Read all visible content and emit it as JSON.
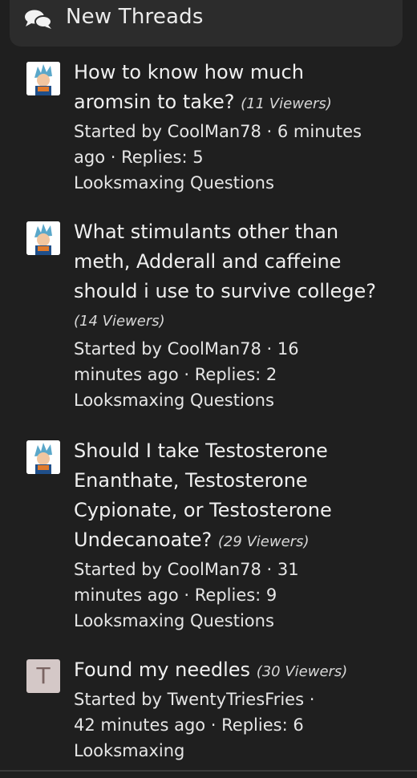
{
  "header": {
    "title": "New Threads",
    "icon": "chat-bubbles-icon"
  },
  "threads": [
    {
      "title": "How to know how much aromsin to take?",
      "viewers": "(11 Viewers)",
      "meta": "Started by CoolMan78 · 6 minutes ago · Replies: 5",
      "forum": "Looksmaxing Questions",
      "avatar": "anime-avatar"
    },
    {
      "title": "What stimulants other than meth, Adderall and caffeine should i use to survive college?",
      "viewers": "(14 Viewers)",
      "meta": "Started by CoolMan78 · 16 minutes ago · Replies: 2",
      "forum": "Looksmaxing Questions",
      "avatar": "anime-avatar"
    },
    {
      "title": "Should I take Testosterone Enanthate, Testosterone Cypionate, or Testosterone Undecanoate?",
      "viewers": "(29 Viewers)",
      "meta": "Started by CoolMan78 · 31 minutes ago · Replies: 9",
      "forum": "Looksmaxing Questions",
      "avatar": "anime-avatar"
    },
    {
      "title": "Found my needles",
      "viewers": "(30 Viewers)",
      "meta": "Started by TwentyTriesFries · 42 minutes ago · Replies: 6",
      "forum": "Looksmaxing",
      "avatar_letter": "T"
    }
  ]
}
